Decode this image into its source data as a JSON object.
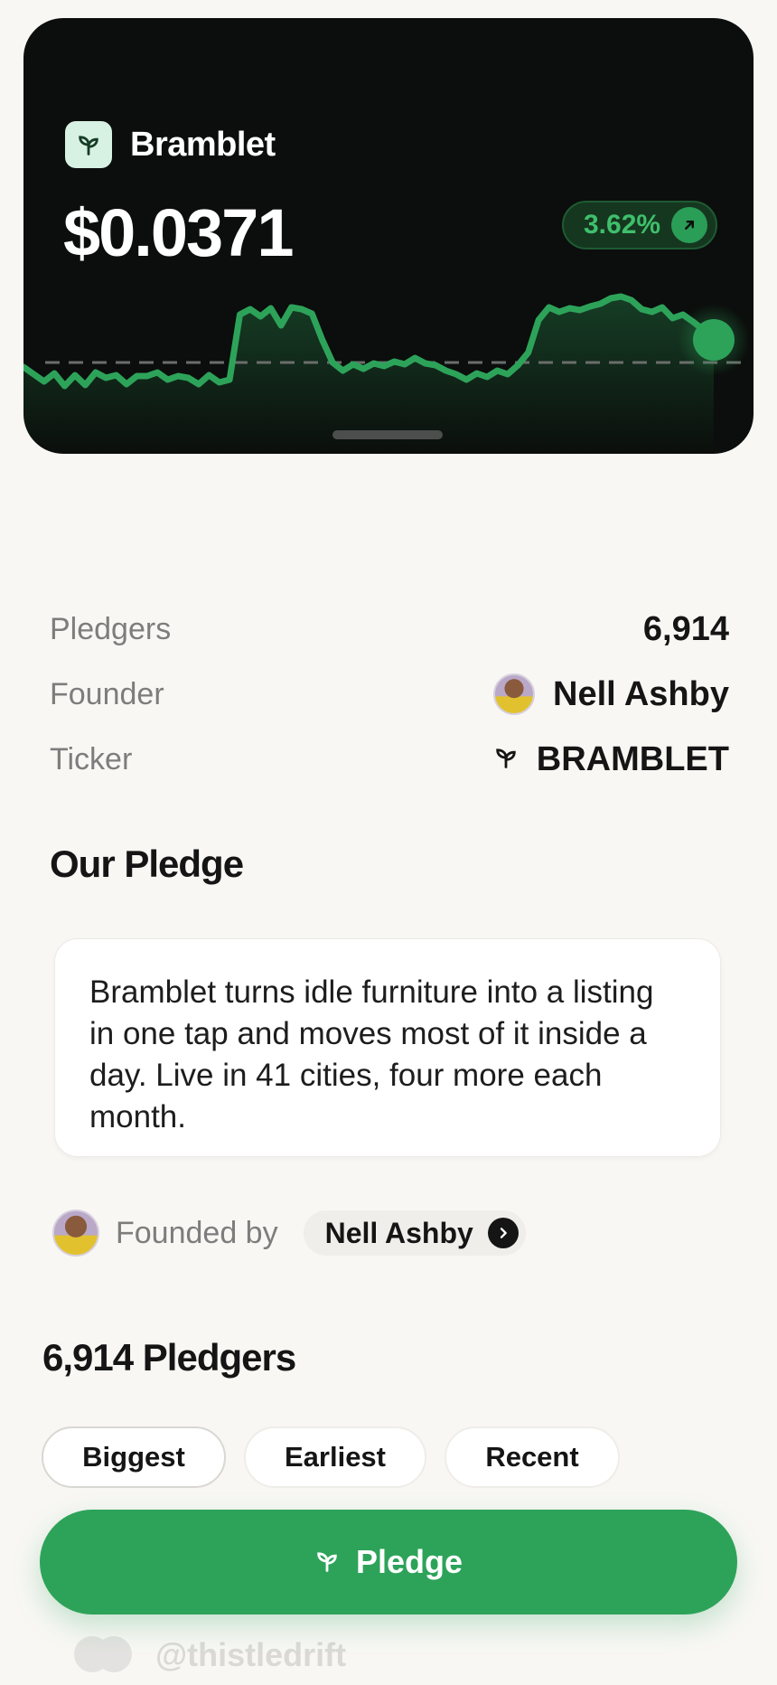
{
  "hero": {
    "brand_name": "Bramblet",
    "price": "$0.0371",
    "change_pct": "3.62%",
    "accent_color": "#2da35a",
    "chart_data": {
      "type": "line",
      "series": [
        {
          "values": [
            54,
            46,
            38,
            47,
            33,
            45,
            34,
            48,
            42,
            45,
            35,
            44,
            44,
            48,
            40,
            44,
            42,
            35,
            45,
            37,
            40,
            112,
            118,
            110,
            119,
            100,
            120,
            118,
            113,
            84,
            59,
            50,
            57,
            52,
            58,
            55,
            60,
            57,
            64,
            58,
            56,
            50,
            46,
            40,
            47,
            43,
            50,
            46,
            56,
            70,
            106,
            120,
            115,
            119,
            117,
            121,
            124,
            130,
            132,
            128,
            118,
            115,
            120,
            108,
            112,
            104,
            95,
            84
          ]
        }
      ],
      "ylim": [
        0,
        160
      ],
      "reference_line": 59
    }
  },
  "stats": {
    "pledgers_label": "Pledgers",
    "pledgers_value": "6,914",
    "founder_label": "Founder",
    "founder_name": "Nell Ashby",
    "ticker_label": "Ticker",
    "ticker_value": "BRAMBLET"
  },
  "pledge": {
    "title": "Our Pledge",
    "text": "Bramblet turns idle furniture into a listing in one tap and moves most of it inside a day. Live in 41 cities, four more each month."
  },
  "founded": {
    "label": "Founded by",
    "name": "Nell Ashby"
  },
  "pledgers": {
    "title": "6,914 Pledgers",
    "filters": [
      "Biggest",
      "Earliest",
      "Recent"
    ]
  },
  "cta": {
    "label": "Pledge"
  },
  "peek": {
    "handle": "@thistledrift"
  }
}
